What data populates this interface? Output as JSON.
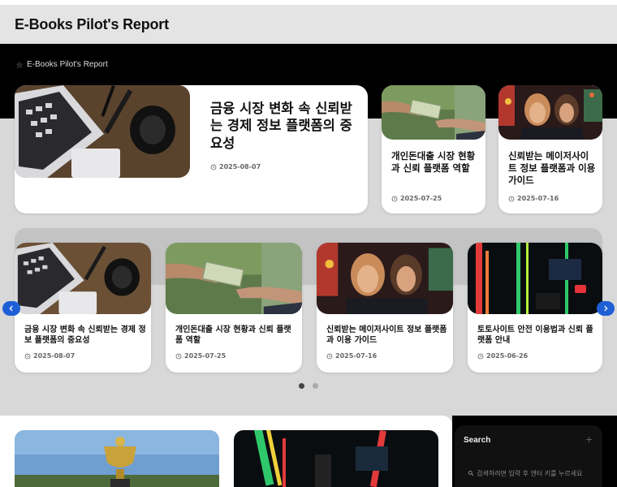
{
  "site": {
    "title": "E-Books Pilot's Report"
  },
  "breadcrumb": {
    "label": "E-Books Pilot's Report",
    "icon": "star-icon"
  },
  "featured": [
    {
      "title": "금융 시장 변화 속 신뢰받는 경제 정보 플랫폼의 중요성",
      "date": "2025-08-07"
    },
    {
      "title": "개인돈대출 시장 현황과 신뢰 플랫폼 역할",
      "date": "2025-07-25"
    },
    {
      "title": "신뢰받는 메이저사이트 정보 플랫폼과 이용 가이드",
      "date": "2025-07-16"
    }
  ],
  "slider": {
    "items": [
      {
        "title": "금융 시장 변화 속 신뢰받는 경제 정보 플랫폼의 중요성",
        "date": "2025-08-07"
      },
      {
        "title": "개인돈대출 시장 현황과 신뢰 플랫폼 역할",
        "date": "2025-07-25"
      },
      {
        "title": "신뢰받는 메이저사이트 정보 플랫폼과 이용 가이드",
        "date": "2025-07-16"
      },
      {
        "title": "토토사이트 안전 이용법과 신뢰 플랫폼 안내",
        "date": "2025-06-26"
      }
    ],
    "active_page": 1,
    "page_count": 2
  },
  "search": {
    "title": "Search",
    "placeholder": "검색하려면 입력 후 엔터 키를 누르세요"
  },
  "colors": {
    "accent": "#1f5fd6",
    "hero": "#000000",
    "header": "#e4e4e4"
  }
}
